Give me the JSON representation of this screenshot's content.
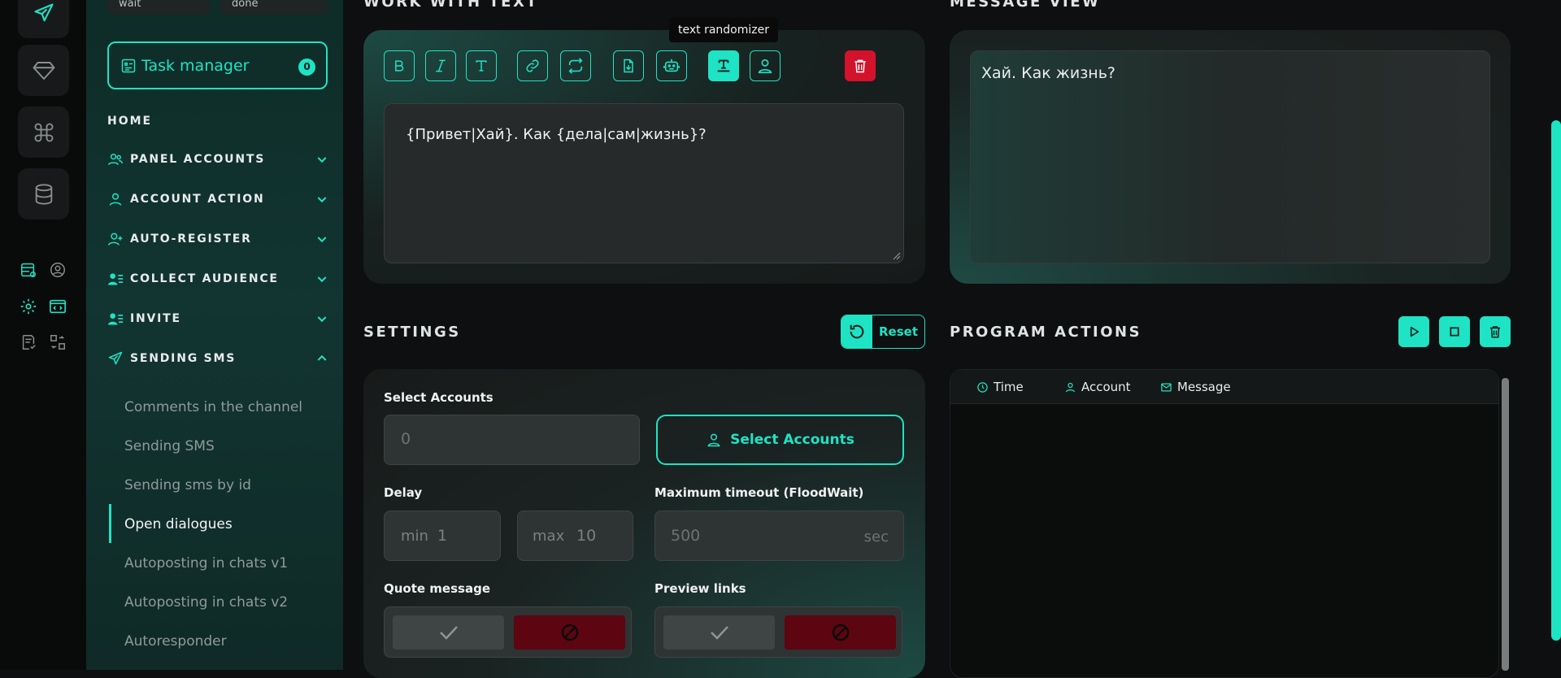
{
  "colors": {
    "accent": "#1ee3c4",
    "danger": "#d3122c",
    "background": "#0d0f10"
  },
  "rail": {
    "icons": [
      "send-icon",
      "diamond-icon",
      "command-icon",
      "database-icon",
      "task-list-icon",
      "user-circle-icon",
      "gear-icon",
      "code-window-icon",
      "checklist-icon",
      "swap-icon"
    ]
  },
  "sidebar": {
    "top_fields": [
      "wait",
      "done"
    ],
    "task_manager": {
      "label": "Task manager",
      "count": "0"
    },
    "home": "HOME",
    "sections": [
      {
        "label": "PANEL ACCOUNTS",
        "icon": "users-icon",
        "expanded": false
      },
      {
        "label": "ACCOUNT ACTION",
        "icon": "user-icon",
        "expanded": false
      },
      {
        "label": "AUTO-REGISTER",
        "icon": "user-plus-icon",
        "expanded": false
      },
      {
        "label": "COLLECT AUDIENCE",
        "icon": "user-list-icon",
        "expanded": false
      },
      {
        "label": "INVITE",
        "icon": "user-list-icon",
        "expanded": false
      },
      {
        "label": "SENDING SMS",
        "icon": "send-icon",
        "expanded": true
      }
    ],
    "sms_items": [
      {
        "label": "Comments in the channel",
        "active": false
      },
      {
        "label": "Sending SMS",
        "active": false
      },
      {
        "label": "Sending sms by id",
        "active": false
      },
      {
        "label": "Open dialogues",
        "active": true
      },
      {
        "label": "Autoposting in chats v1",
        "active": false
      },
      {
        "label": "Autoposting in chats v2",
        "active": false
      },
      {
        "label": "Autoresponder",
        "active": false
      }
    ]
  },
  "work_with_text": {
    "title": "WORK WITH TEXT",
    "toolbar": [
      "bold-icon",
      "italic-icon",
      "text-icon",
      "link-icon",
      "repeat-icon",
      "file-import-icon",
      "robot-icon",
      "text-randomizer-icon",
      "user-icon"
    ],
    "tooltip": "text randomizer",
    "text": "{Привет|Хай}. Как {дела|сам|жизнь}?"
  },
  "message_view": {
    "title": "MESSAGE VIEW",
    "text": "Хай. Как жизнь?"
  },
  "settings": {
    "title": "SETTINGS",
    "reset_label": "Reset",
    "select_accounts_label": "Select Accounts",
    "accounts_value": "0",
    "select_accounts_button": "Select Accounts",
    "delay_label": "Delay",
    "delay_min_prefix": "min",
    "delay_min": "1",
    "delay_max_prefix": "max",
    "delay_max": "10",
    "timeout_label": "Maximum timeout (FloodWait)",
    "timeout_value": "500",
    "timeout_unit": "sec",
    "quote_label": "Quote message",
    "preview_label": "Preview links"
  },
  "program_actions": {
    "title": "PROGRAM ACTIONS",
    "columns": [
      "Time",
      "Account",
      "Message"
    ]
  }
}
